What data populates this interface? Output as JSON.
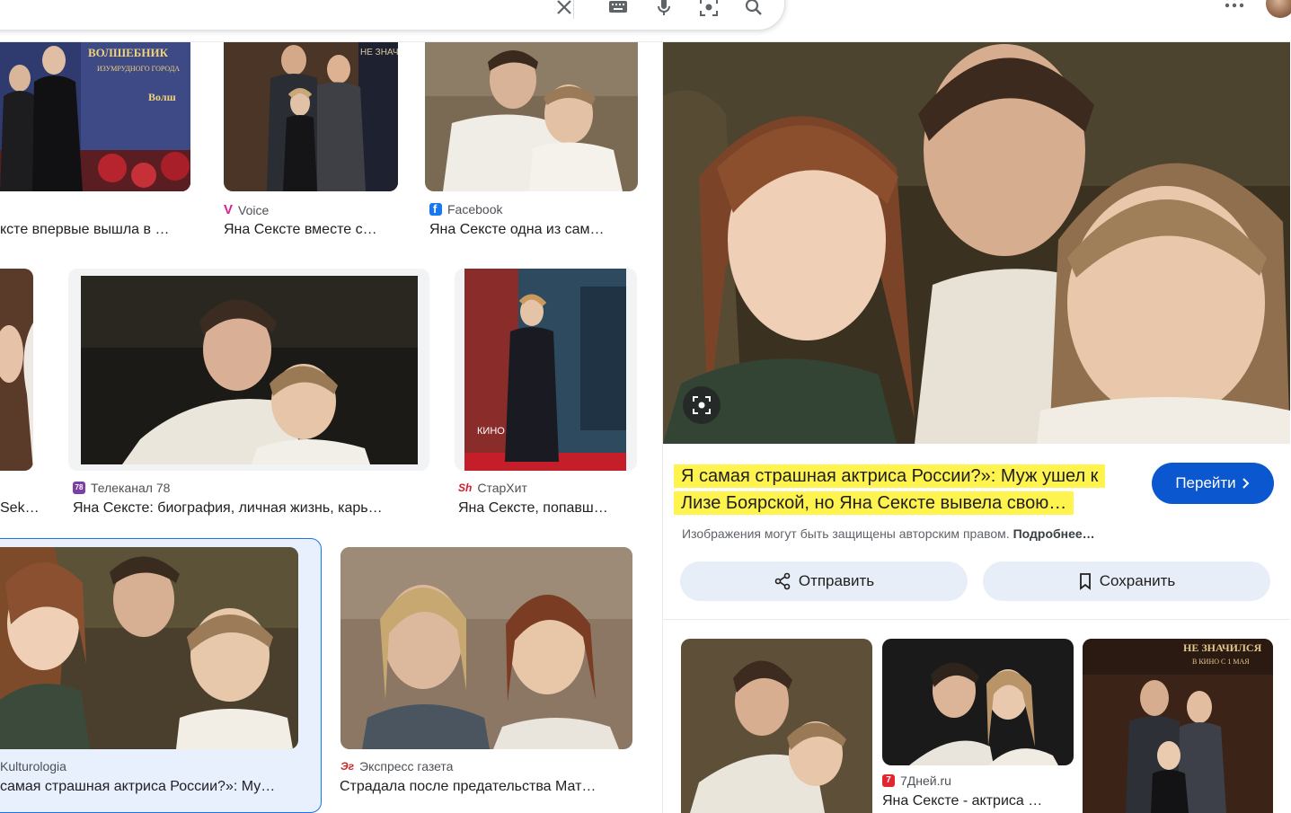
{
  "results": [
    {
      "source": "",
      "title": "ксте впервые вышла в …"
    },
    {
      "source": "Voice",
      "title": "Яна Сексте вместе с…"
    },
    {
      "source": "Facebook",
      "title": "Яна Сексте одна из сам…"
    },
    {
      "source": "",
      "title": "Sek…"
    },
    {
      "source": "Телеканал 78",
      "title": "Яна Сексте: биография, личная жизнь, карь…"
    },
    {
      "source": "СтарХит",
      "title": "Яна Сексте, попавш…"
    },
    {
      "source": "Kulturologia",
      "title": "самая страшная актриса России?»: Му…"
    },
    {
      "source": "Экспресс газета",
      "title": "Страдала после предательства Мат…"
    }
  ],
  "panel": {
    "title": "Я самая страшная актриса России?»: Муж ушел к Лизе Боярской, но Яна Сексте вывела свою…",
    "go_label": "Перейти",
    "copyright_text": "Изображения могут быть защищены авторским правом.",
    "more_label": "Подробнее…",
    "share_label": "Отправить",
    "save_label": "Сохранить",
    "related": [
      {
        "source": "",
        "title": ""
      },
      {
        "source": "7Дней.ru",
        "title": "Яна Сексте - актриса …"
      },
      {
        "source": "",
        "title": ""
      }
    ]
  },
  "image_texts": {
    "poster1_line1": "ВОЛШЕБНИК",
    "poster1_line2": "ИЗУМРУДНОГО ГОРОДА",
    "poster2": "НЕ ЗНАЧИ",
    "starhit_poster": "КИНО С 1",
    "related3_line1": "НЕ ЗНАЧИЛСЯ",
    "related3_line2": "В КИНО С 1 МАЯ"
  },
  "colors": {
    "highlight": "#fff34d",
    "primary_button": "#0b57d0",
    "selected_border": "#1a73e8"
  }
}
